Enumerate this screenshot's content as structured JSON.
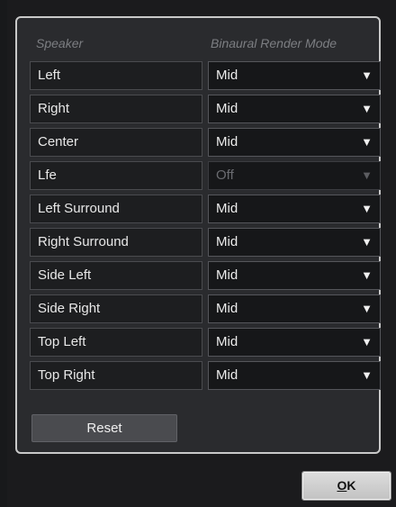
{
  "header": {
    "speaker_label": "Speaker",
    "mode_label": "Binaural Render Mode"
  },
  "rows": [
    {
      "speaker": "Left",
      "mode": "Mid",
      "enabled": true
    },
    {
      "speaker": "Right",
      "mode": "Mid",
      "enabled": true
    },
    {
      "speaker": "Center",
      "mode": "Mid",
      "enabled": true
    },
    {
      "speaker": "Lfe",
      "mode": "Off",
      "enabled": false
    },
    {
      "speaker": "Left Surround",
      "mode": "Mid",
      "enabled": true
    },
    {
      "speaker": "Right Surround",
      "mode": "Mid",
      "enabled": true
    },
    {
      "speaker": "Side Left",
      "mode": "Mid",
      "enabled": true
    },
    {
      "speaker": "Side Right",
      "mode": "Mid",
      "enabled": true
    },
    {
      "speaker": "Top Left",
      "mode": "Mid",
      "enabled": true
    },
    {
      "speaker": "Top Right",
      "mode": "Mid",
      "enabled": true
    }
  ],
  "dropdown_icon": "triangle-down-icon",
  "buttons": {
    "reset_label": "Reset",
    "ok_mnemonic": "O",
    "ok_rest": "K"
  }
}
